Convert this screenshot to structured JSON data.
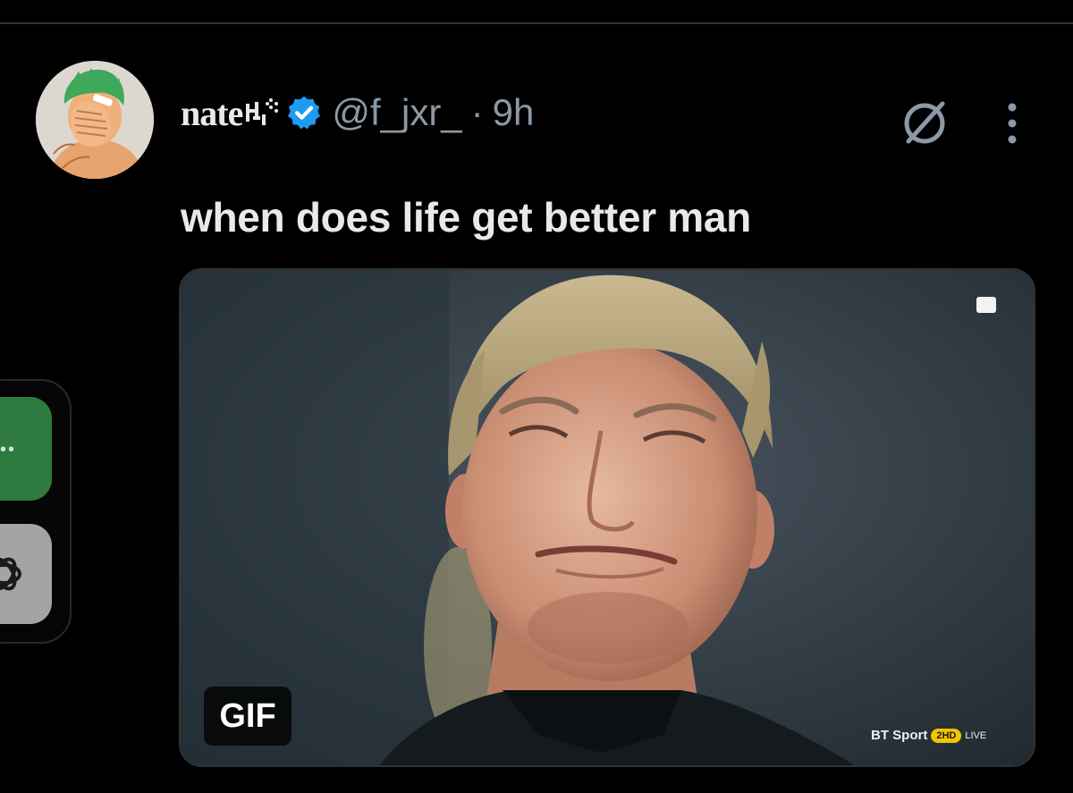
{
  "tweet": {
    "display_name": "nate",
    "handle": "@f_jxr_",
    "separator": "·",
    "timestamp": "9h",
    "text": "when does life get better man",
    "verified": true,
    "verified_color": "#1d9bf0"
  },
  "media": {
    "type_badge": "GIF",
    "broadcaster": {
      "name": "BT Sport",
      "channel": "2HD",
      "live": "LIVE"
    }
  },
  "actions": {
    "grok_icon": "grok-slash-circle-icon",
    "more_icon": "vertical-dots-icon"
  },
  "side_dock": {
    "items": [
      {
        "icon": "more-dots-icon",
        "color": "#2f7a3e"
      },
      {
        "icon": "openai-logo-icon",
        "color": "#a4a4a4"
      }
    ]
  },
  "colors": {
    "background": "#000000",
    "text_primary": "#e7e9ea",
    "text_secondary": "#8b98a5",
    "divider": "#2f3336"
  }
}
